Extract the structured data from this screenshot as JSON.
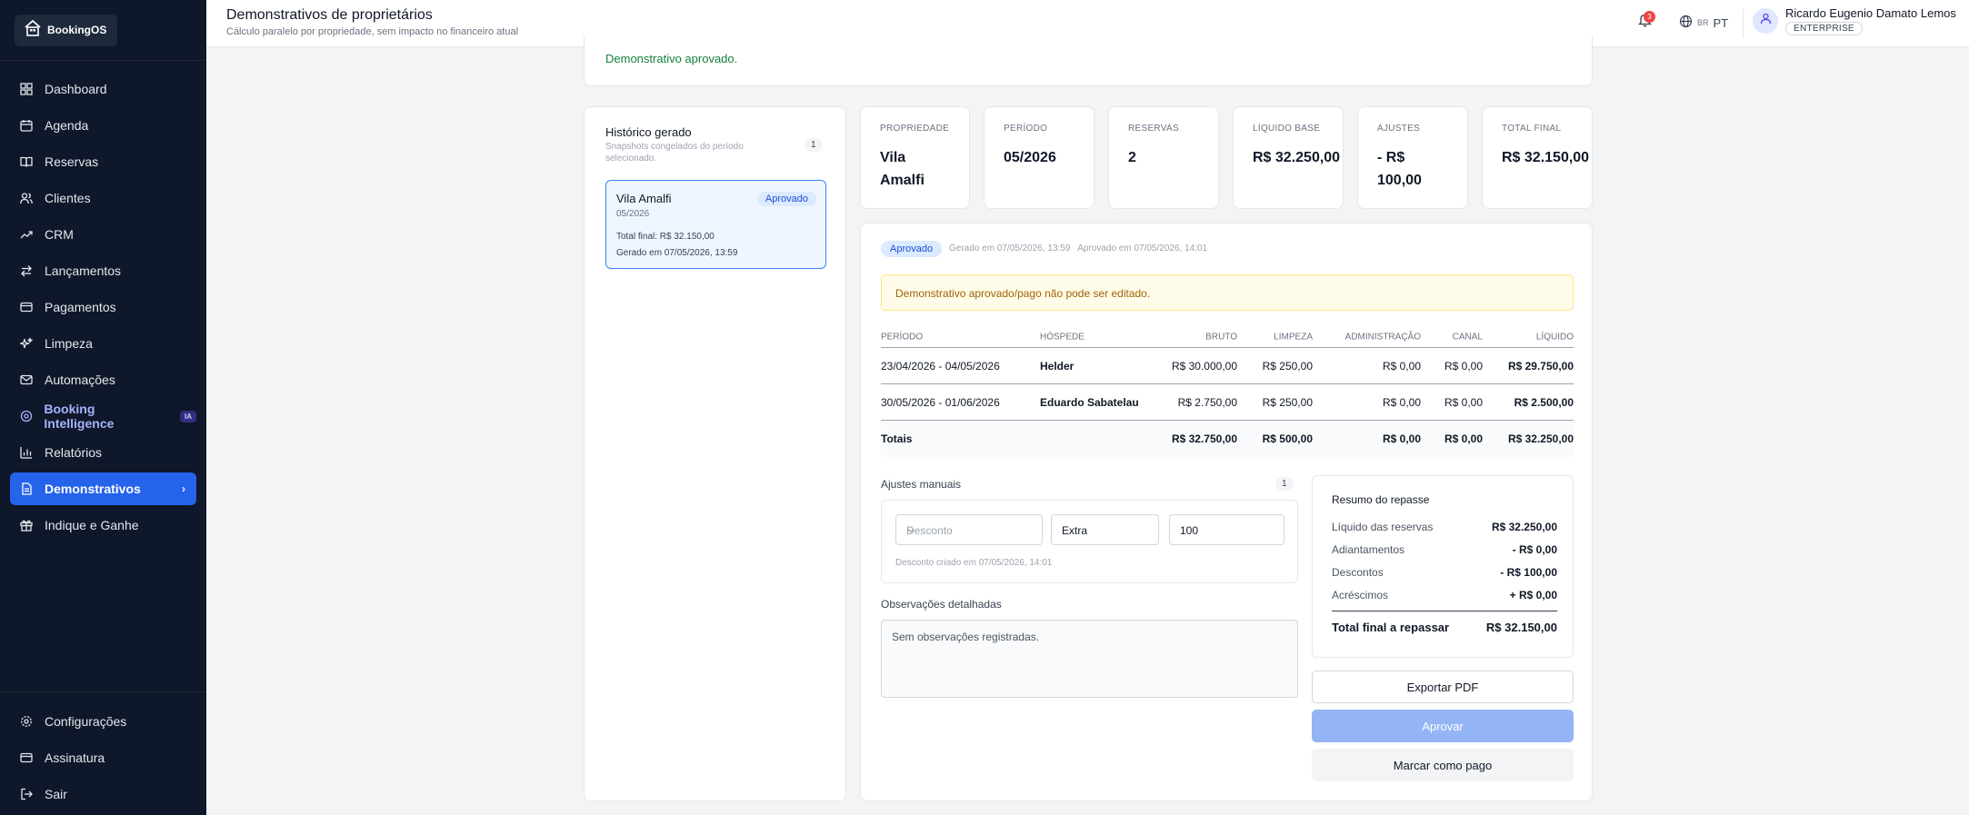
{
  "app": {
    "name": "BookingOS"
  },
  "sidebar": {
    "items": [
      {
        "label": "Dashboard"
      },
      {
        "label": "Agenda"
      },
      {
        "label": "Reservas"
      },
      {
        "label": "Clientes"
      },
      {
        "label": "CRM"
      },
      {
        "label": "Lançamentos"
      },
      {
        "label": "Pagamentos"
      },
      {
        "label": "Limpeza"
      },
      {
        "label": "Automações"
      },
      {
        "label": "Booking Intelligence",
        "badge": "IA"
      },
      {
        "label": "Relatórios"
      },
      {
        "label": "Demonstrativos",
        "active": true
      },
      {
        "label": "Indique e Ganhe"
      }
    ],
    "bottom": [
      {
        "label": "Configurações"
      },
      {
        "label": "Assinatura"
      },
      {
        "label": "Sair"
      }
    ]
  },
  "header": {
    "title": "Demonstrativos de proprietários",
    "subtitle": "Cálculo paralelo por propriedade, sem impacto no financeiro atual",
    "notifications": "3",
    "lang_flag": "BR",
    "lang": "PT",
    "user_name": "Ricardo Eugenio Damato Lemos",
    "plan": "ENTERPRISE"
  },
  "banner": {
    "text": "Demonstrativo aprovado."
  },
  "history": {
    "title": "Histórico gerado",
    "subtitle": "Snapshots congelados do período selecionado.",
    "count": "1",
    "items": [
      {
        "name": "Vila Amalfi",
        "status": "Aprovado",
        "period": "05/2026",
        "total": "Total final: R$ 32.150,00",
        "generated": "Gerado em 07/05/2026, 13:59"
      }
    ]
  },
  "stats": [
    {
      "label": "PROPRIEDADE",
      "value": "Vila Amalfi"
    },
    {
      "label": "PERÍODO",
      "value": "05/2026"
    },
    {
      "label": "RESERVAS",
      "value": "2"
    },
    {
      "label": "LÍQUIDO BASE",
      "value": "R$ 32.250,00"
    },
    {
      "label": "AJUSTES",
      "value": "- R$ 100,00"
    },
    {
      "label": "TOTAL FINAL",
      "value": "R$ 32.150,00"
    }
  ],
  "statement": {
    "status": "Aprovado",
    "meta": "Gerado em 07/05/2026, 13:59   Aprovado em 07/05/2026, 14:01",
    "warning": "Demonstrativo aprovado/pago não pode ser editado.",
    "columns": [
      "PERÍODO",
      "HÓSPEDE",
      "BRUTO",
      "LIMPEZA",
      "ADMINISTRAÇÃO",
      "CANAL",
      "LÍQUIDO"
    ],
    "rows": [
      [
        "23/04/2026 - 04/05/2026",
        "Helder",
        "R$ 30.000,00",
        "R$ 250,00",
        "R$ 0,00",
        "R$ 0,00",
        "R$ 29.750,00"
      ],
      [
        "30/05/2026 - 01/06/2026",
        "Eduardo Sabatelau",
        "R$ 2.750,00",
        "R$ 250,00",
        "R$ 0,00",
        "R$ 0,00",
        "R$ 2.500,00"
      ]
    ],
    "totals": [
      "Totais",
      "",
      "R$ 32.750,00",
      "R$ 500,00",
      "R$ 0,00",
      "R$ 0,00",
      "R$ 32.250,00"
    ]
  },
  "adjustments": {
    "title": "Ajustes manuais",
    "count": "1",
    "type": "Desconto",
    "description": "Extra",
    "amount": "100",
    "note": "Desconto criado em 07/05/2026, 14:01"
  },
  "observations": {
    "title": "Observações detalhadas",
    "text": "Sem observações registradas."
  },
  "summary": {
    "title": "Resumo do repasse",
    "rows": [
      {
        "label": "Líquido das reservas",
        "value": "R$ 32.250,00"
      },
      {
        "label": "Adiantamentos",
        "value": "- R$ 0,00"
      },
      {
        "label": "Descontos",
        "value": "- R$ 100,00"
      },
      {
        "label": "Acréscimos",
        "value": "+ R$ 0,00"
      }
    ],
    "total_label": "Total final a repassar",
    "total_value": "R$ 32.150,00"
  },
  "actions": {
    "export": "Exportar PDF",
    "approve": "Aprovar",
    "mark_paid": "Marcar como pago"
  }
}
